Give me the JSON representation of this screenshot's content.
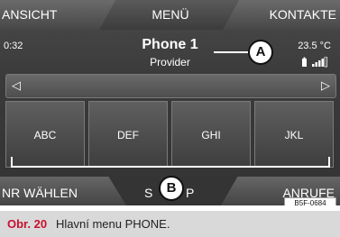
{
  "top_tabs": {
    "left": "ANSICHT",
    "middle": "MENÜ",
    "right": "KONTAKTE"
  },
  "info": {
    "time": "0:32",
    "title": "Phone 1",
    "provider": "Provider",
    "temperature": "23.5 °C"
  },
  "nav": {
    "left_arrow": "◁",
    "right_arrow": "▷"
  },
  "keys": [
    "ABC",
    "DEF",
    "GHI",
    "JKL"
  ],
  "bottom_tabs": {
    "left": "NR WÄHLEN",
    "middle": "S",
    "middle_suffix": "P",
    "right": "ANRUFE"
  },
  "callouts": {
    "a": "A",
    "b": "B"
  },
  "code": "B5F-0684",
  "caption": {
    "label": "Obr. 20",
    "text": "Hlavní menu PHONE."
  },
  "colors": {
    "caption_label": "#c8102e",
    "screen_bg": "#3a3a3a"
  }
}
